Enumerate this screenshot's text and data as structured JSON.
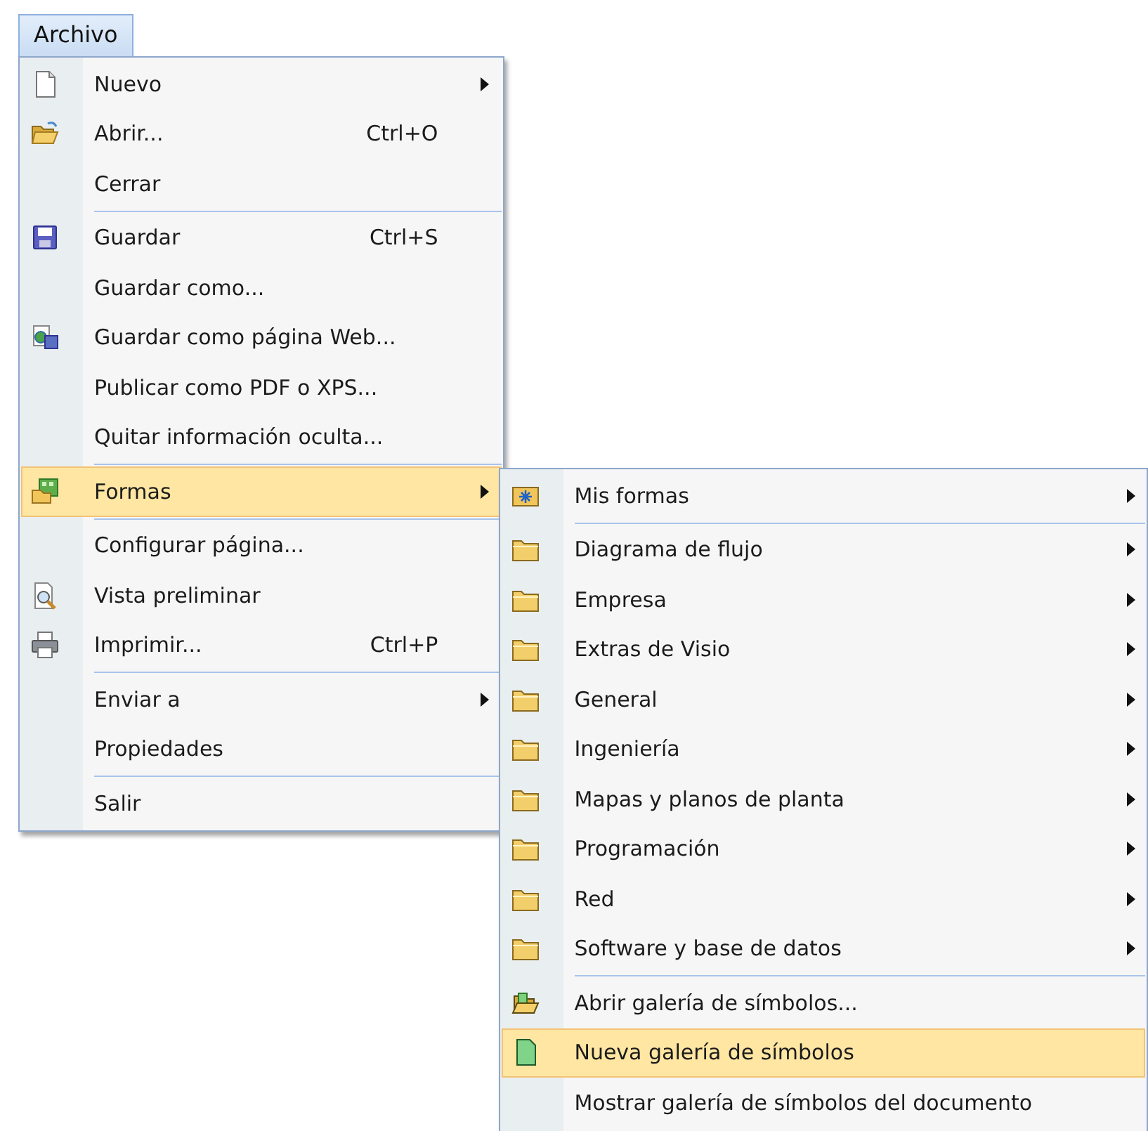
{
  "menu_bar": [
    {
      "label": "Archivo",
      "selected": true
    }
  ],
  "file_menu": {
    "sections": [
      [
        {
          "label": "Nuevo",
          "has_submenu": true,
          "selected": false
        },
        {
          "label": "Abrir...",
          "shortcut": "Ctrl+O",
          "has_submenu": false,
          "selected": false
        },
        {
          "label": "Cerrar",
          "has_submenu": false,
          "selected": false
        }
      ],
      [
        {
          "label": "Guardar",
          "shortcut": "Ctrl+S",
          "has_submenu": false,
          "selected": false
        },
        {
          "label": "Guardar como...",
          "has_submenu": false,
          "selected": false
        },
        {
          "label": "Guardar como página Web...",
          "has_submenu": false,
          "selected": false
        },
        {
          "label": "Publicar como PDF o XPS...",
          "has_submenu": false,
          "selected": false
        },
        {
          "label": "Quitar información oculta...",
          "has_submenu": false,
          "selected": false
        }
      ],
      [
        {
          "label": "Formas",
          "has_submenu": true,
          "selected": true
        }
      ],
      [
        {
          "label": "Configurar página...",
          "has_submenu": false,
          "selected": false
        },
        {
          "label": "Vista preliminar",
          "has_submenu": false,
          "selected": false
        },
        {
          "label": "Imprimir...",
          "shortcut": "Ctrl+P",
          "has_submenu": false,
          "selected": false
        }
      ],
      [
        {
          "label": "Enviar a",
          "has_submenu": true,
          "selected": false
        },
        {
          "label": "Propiedades",
          "has_submenu": false,
          "selected": false
        }
      ],
      [
        {
          "label": "Salir",
          "has_submenu": false,
          "selected": false
        }
      ]
    ]
  },
  "shapes_submenu": {
    "sections": [
      [
        {
          "label": "Mis formas",
          "has_submenu": true,
          "selected": false
        }
      ],
      [
        {
          "label": "Diagrama de flujo",
          "has_submenu": true,
          "selected": false
        },
        {
          "label": "Empresa",
          "has_submenu": true,
          "selected": false
        },
        {
          "label": "Extras de Visio",
          "has_submenu": true,
          "selected": false
        },
        {
          "label": "General",
          "has_submenu": true,
          "selected": false
        },
        {
          "label": "Ingeniería",
          "has_submenu": true,
          "selected": false
        },
        {
          "label": "Mapas y planos de planta",
          "has_submenu": true,
          "selected": false
        },
        {
          "label": "Programación",
          "has_submenu": true,
          "selected": false
        },
        {
          "label": "Red",
          "has_submenu": true,
          "selected": false
        },
        {
          "label": "Software y base de datos",
          "has_submenu": true,
          "selected": false
        }
      ],
      [
        {
          "label": "Abrir galería de símbolos...",
          "has_submenu": false,
          "selected": false
        },
        {
          "label": "Nueva galería de símbolos",
          "has_submenu": false,
          "selected": true
        },
        {
          "label": "Mostrar galería de símbolos del documento",
          "has_submenu": false,
          "selected": false
        }
      ]
    ]
  }
}
